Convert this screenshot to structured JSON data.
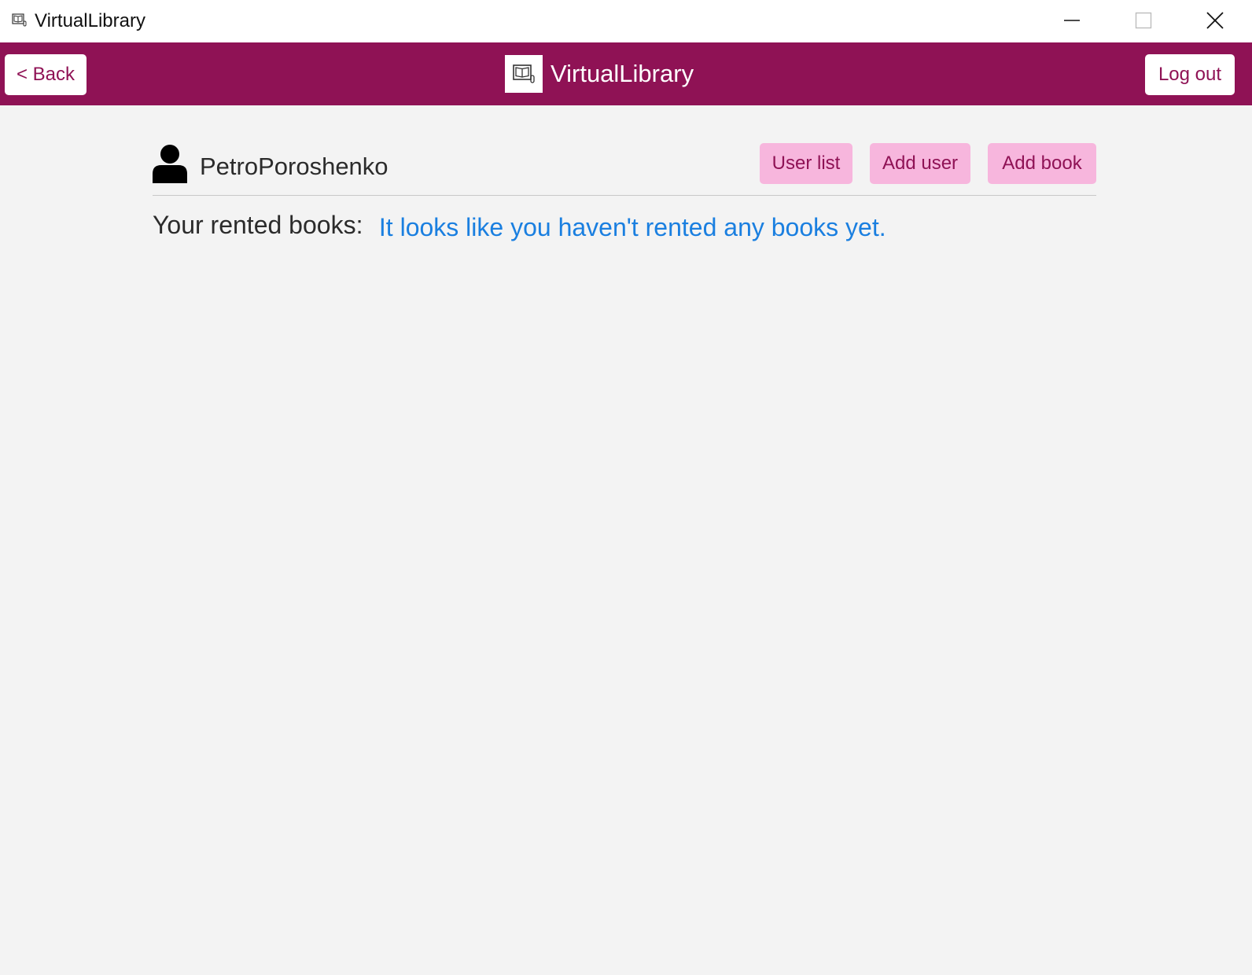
{
  "window": {
    "title": "VirtualLibrary",
    "app_icon": "book-monitor-icon",
    "controls": [
      "minimize-icon",
      "maximize-icon",
      "close-icon"
    ]
  },
  "header": {
    "back_label": "< Back",
    "brand_name": "VirtualLibrary",
    "logo_icon": "book-monitor-icon",
    "logout_label": "Log out"
  },
  "user": {
    "icon": "user-icon",
    "name": "PetroPoroshenko"
  },
  "actions": {
    "user_list_label": "User list",
    "add_user_label": "Add user",
    "add_book_label": "Add book"
  },
  "rented": {
    "label": "Your rented books:",
    "empty_message": "It looks like you haven't rented any books yet."
  },
  "colors": {
    "header_bg": "#8f1255",
    "accent_button_bg": "#f7b6dd",
    "accent_text": "#8f1255",
    "link_blue": "#1a7fe0",
    "page_bg": "#f3f3f3"
  }
}
